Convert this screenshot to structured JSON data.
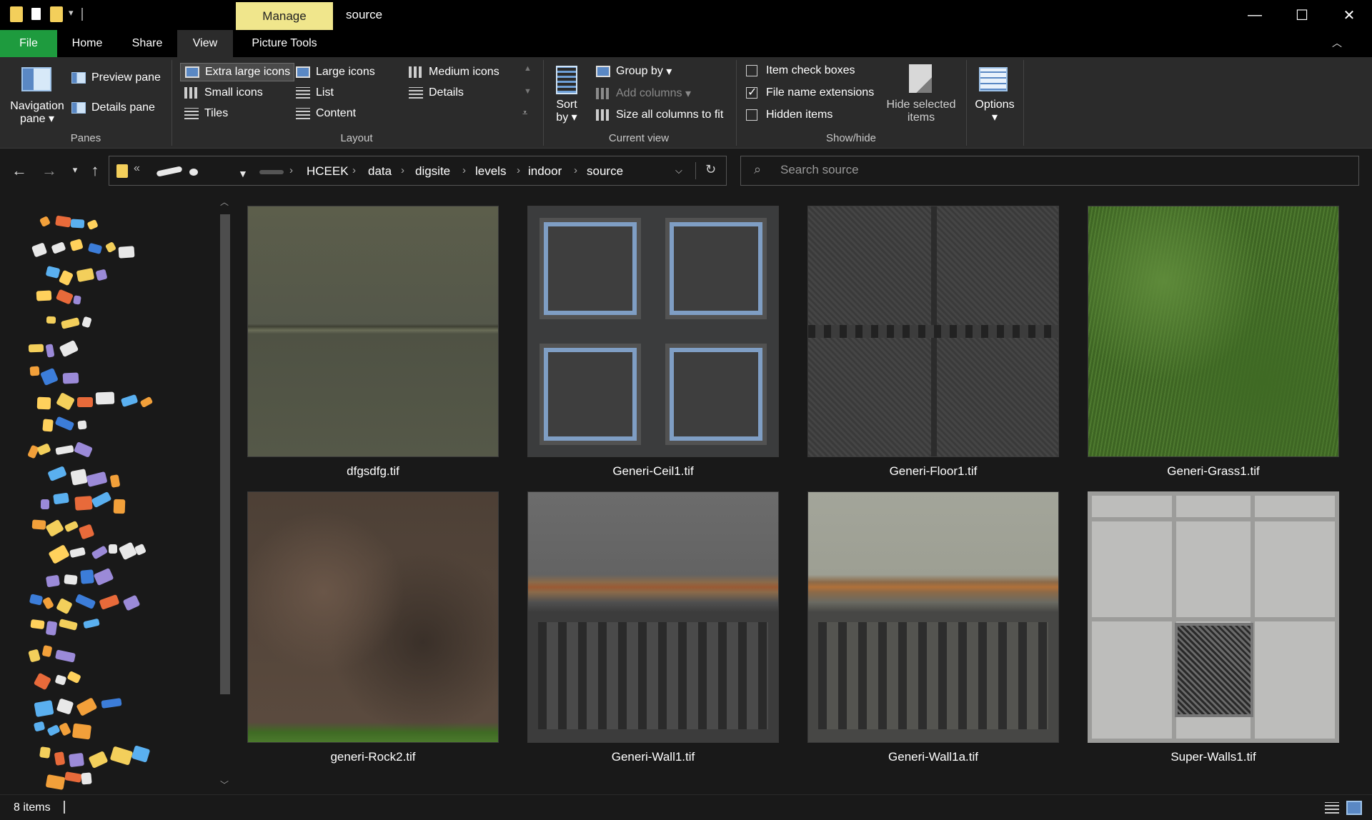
{
  "titlebar": {
    "manage_label": "Manage",
    "window_title": "source",
    "minimize": "—",
    "maximize": "☐",
    "close": "✕"
  },
  "tabs": [
    "File",
    "Home",
    "Share",
    "View",
    "Picture Tools"
  ],
  "ribbon": {
    "panes": {
      "label": "Panes",
      "navigation_pane": "Navigation pane",
      "preview_pane": "Preview pane",
      "details_pane": "Details pane"
    },
    "layout": {
      "label": "Layout",
      "options": [
        "Extra large icons",
        "Large icons",
        "Medium icons",
        "Small icons",
        "List",
        "Details",
        "Tiles",
        "Content"
      ],
      "selected": "Extra large icons"
    },
    "current_view": {
      "label": "Current view",
      "sort_by": "Sort by",
      "group_by": "Group by",
      "add_columns": "Add columns",
      "size_all_columns": "Size all columns to fit"
    },
    "show_hide": {
      "label": "Show/hide",
      "item_check_boxes": "Item check boxes",
      "file_name_extensions": "File name extensions",
      "hidden_items": "Hidden items",
      "hide_selected_items": "Hide selected items",
      "checked": [
        false,
        true,
        false
      ]
    },
    "options": "Options"
  },
  "address": {
    "breadcrumbs": [
      "HCEEK",
      "data",
      "digsite",
      "levels",
      "indoor",
      "source"
    ],
    "search_placeholder": "Search source"
  },
  "files": [
    {
      "name": "dfgsdfg.tif"
    },
    {
      "name": "Generi-Ceil1.tif"
    },
    {
      "name": "Generi-Floor1.tif"
    },
    {
      "name": "Generi-Grass1.tif"
    },
    {
      "name": "generi-Rock2.tif"
    },
    {
      "name": "Generi-Wall1.tif"
    },
    {
      "name": "Generi-Wall1a.tif"
    },
    {
      "name": "Super-Walls1.tif"
    }
  ],
  "status": {
    "item_count": "8 items"
  },
  "colors": {
    "file_tab": "#1e9b3e",
    "manage_tab": "#f0e68c",
    "background": "#191919",
    "ribbon": "#2b2b2b"
  }
}
